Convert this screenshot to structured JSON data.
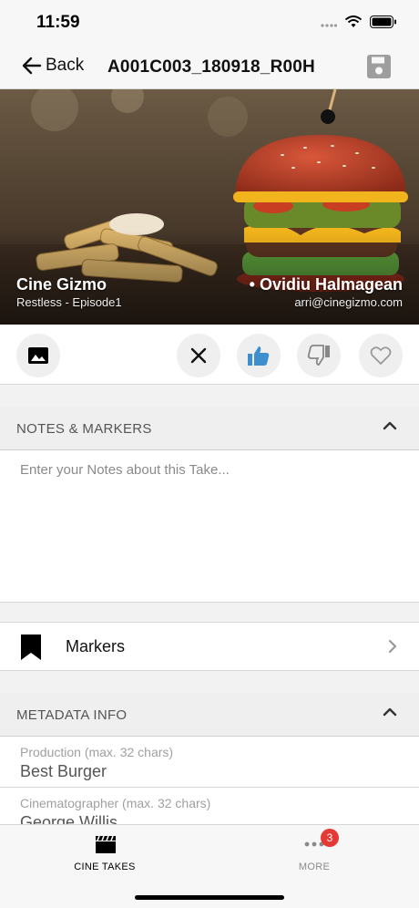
{
  "status": {
    "time": "11:59"
  },
  "nav": {
    "back_label": "Back",
    "title": "A001C003_180918_R00H"
  },
  "hero": {
    "project": "Cine Gizmo",
    "subtitle": "Restless  - Episode1",
    "person": "• Ovidiu Halmagean",
    "email": "arri@cinegizmo.com"
  },
  "actions": {
    "thumbs_up_color": "#3d8fd0"
  },
  "notes": {
    "title": "NOTES & MARKERS",
    "placeholder": "Enter your Notes about this Take..."
  },
  "markers": {
    "label": "Markers"
  },
  "metadata": {
    "title": "METADATA INFO",
    "fields": [
      {
        "label": "Production (max. 32 chars)",
        "value": "Best Burger"
      },
      {
        "label": "Cinematographer (max. 32 chars)",
        "value": "George Willis"
      }
    ]
  },
  "tabbar": {
    "tabs": [
      {
        "label": "CINE TAKES",
        "icon": "clapperboard-icon",
        "active": true
      },
      {
        "label": "MORE",
        "icon": "more-dots-icon",
        "active": false,
        "badge": "3"
      }
    ]
  }
}
